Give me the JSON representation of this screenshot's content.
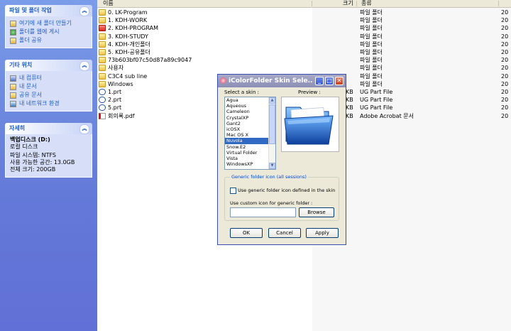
{
  "taskpane": {
    "panel1": {
      "title": "파일 및 폴더 작업",
      "items": [
        {
          "label": "여기에 새 폴더 만들기",
          "icon": "new-folder-icon"
        },
        {
          "label": "폴더를 웹에 게시",
          "icon": "globe-icon"
        },
        {
          "label": "폴더 공유",
          "icon": "share-folder-icon"
        }
      ]
    },
    "panel2": {
      "title": "기타 위치",
      "items": [
        {
          "label": "내 컴퓨터",
          "icon": "computer-icon"
        },
        {
          "label": "내 문서",
          "icon": "documents-folder-icon"
        },
        {
          "label": "공유 문서",
          "icon": "shared-documents-icon"
        },
        {
          "label": "내 네트워크 환경",
          "icon": "network-icon"
        }
      ]
    },
    "panel3": {
      "title": "자세히",
      "drive_name": "백업디스크 (D:)",
      "drive_type": "로컬 디스크",
      "filesystem": "파일 시스템: NTFS",
      "free_space": "사용 가능한 공간: 13.0GB",
      "total_size": "전체 크기: 200GB"
    }
  },
  "list": {
    "headers": {
      "name": "이름",
      "size": "크기",
      "type": "종류"
    },
    "rows": [
      {
        "name": "0. LK-Program",
        "size": "",
        "type": "파일 폴더",
        "date": "20",
        "icon": "folder-icon"
      },
      {
        "name": "1. KDH-WORK",
        "size": "",
        "type": "파일 폴더",
        "date": "20",
        "icon": "folder-icon"
      },
      {
        "name": "2. KDH-PROGRAM",
        "size": "",
        "type": "파일 폴더",
        "date": "20",
        "icon": "red-folder-icon"
      },
      {
        "name": "3. KDH-STUDY",
        "size": "",
        "type": "파일 폴더",
        "date": "20",
        "icon": "folder-icon"
      },
      {
        "name": "4. KDH-개인폴더",
        "size": "",
        "type": "파일 폴더",
        "date": "20",
        "icon": "folder-icon"
      },
      {
        "name": "5. KDH-공유폴더",
        "size": "",
        "type": "파일 폴더",
        "date": "20",
        "icon": "folder-icon"
      },
      {
        "name": "73b603bf07c50d87a89c9047",
        "size": "",
        "type": "파일 폴더",
        "date": "20",
        "icon": "folder-icon"
      },
      {
        "name": "사용자",
        "size": "",
        "type": "파일 폴더",
        "date": "20",
        "icon": "folder-icon"
      },
      {
        "name": "C3C4 sub line",
        "size": "",
        "type": "파일 폴더",
        "date": "20",
        "icon": "folder-icon"
      },
      {
        "name": "Windows",
        "size": "",
        "type": "파일 폴더",
        "date": "20",
        "icon": "folder-icon"
      },
      {
        "name": "1.prt",
        "size": "KB",
        "type": "UG Part File",
        "date": "20",
        "icon": "prt-file-icon"
      },
      {
        "name": "2.prt",
        "size": "KB",
        "type": "UG Part File",
        "date": "20",
        "icon": "prt-file-icon"
      },
      {
        "name": "5.prt",
        "size": "KB",
        "type": "UG Part File",
        "date": "20",
        "icon": "prt-file-icon"
      },
      {
        "name": "회의록.pdf",
        "size": "KB",
        "type": "Adobe Acrobat 문서",
        "date": "20",
        "icon": "pdf-file-icon"
      }
    ]
  },
  "dialog": {
    "title": "iColorFolder Skin Sele...",
    "select_skin_label": "Select a skin :",
    "preview_label": "Preview :",
    "skins": [
      "Agua",
      "Aqueous",
      "Cameleon",
      "CrystalXP",
      "Gant2",
      "icOSX",
      "Mac OS X",
      "Nuvola",
      "Snow.E2",
      "Virtual Folder",
      "Vista",
      "WindowsXP"
    ],
    "selected_skin": "Nuvola",
    "group_title": "Generic folder icon (all sessions)",
    "checkbox_label": "Use generic folder icon defined in the skin",
    "checkbox_checked": false,
    "custom_icon_label": "Use custom icon for generic folder :",
    "custom_icon_value": "",
    "browse_label": "Browse",
    "ok_label": "OK",
    "cancel_label": "Cancel",
    "apply_label": "Apply",
    "minimize_glyph": "_",
    "maximize_glyph": "□",
    "close_glyph": "✕",
    "preview_icon": "blue-folder-icon"
  },
  "colors": {
    "taskpane_bg": "#6b83df",
    "link": "#215dc6",
    "selection": "#316ac5",
    "dialog_title": "#9a9cc0"
  }
}
